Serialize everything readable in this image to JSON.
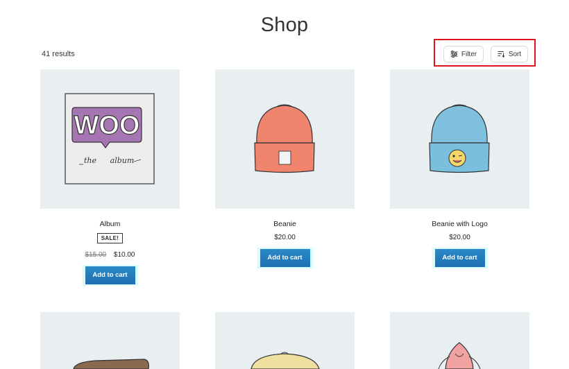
{
  "page": {
    "title": "Shop",
    "result_count": "41 results"
  },
  "controls": {
    "filter_label": "Filter",
    "sort_label": "Sort"
  },
  "products": [
    {
      "name": "Album",
      "sale_badge": "SALE!",
      "old_price": "$15.00",
      "price": "$10.00",
      "cart_label": "Add to cart",
      "art_text_1": "WOO",
      "art_text_2": "the",
      "art_text_3": "album"
    },
    {
      "name": "Beanie",
      "price": "$20.00",
      "cart_label": "Add to cart"
    },
    {
      "name": "Beanie with Logo",
      "price": "$20.00",
      "cart_label": "Add to cart"
    }
  ],
  "colors": {
    "accent_button": "#1e6fb3",
    "highlight_border": "#e0141c",
    "image_bg": "#e9eef0"
  },
  "icons": {
    "filter": "sliders-icon",
    "sort": "sort-icon"
  }
}
